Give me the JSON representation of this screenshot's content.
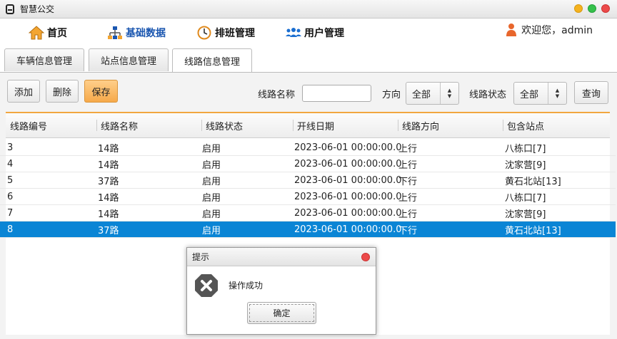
{
  "window": {
    "title": "智慧公交"
  },
  "nav": {
    "items": [
      {
        "label": "首页",
        "icon": "home-icon"
      },
      {
        "label": "基础数据",
        "icon": "hierarchy-icon"
      },
      {
        "label": "排班管理",
        "icon": "clock-icon"
      },
      {
        "label": "用户管理",
        "icon": "users-icon"
      }
    ],
    "active": "基础数据",
    "active_color": "#1a56b0",
    "welcome": "欢迎您，admin"
  },
  "tabs": [
    "车辆信息管理",
    "站点信息管理",
    "线路信息管理"
  ],
  "active_tab": "线路信息管理",
  "toolbar": {
    "add_label": "添加",
    "delete_label": "删除",
    "save_label": "保存",
    "route_name_label": "线路名称",
    "route_name_value": "",
    "direction_label": "方向",
    "direction_value": "全部",
    "status_label": "线路状态",
    "status_value": "全部",
    "query_label": "查询"
  },
  "table": {
    "columns": [
      "线路编号",
      "线路名称",
      "线路状态",
      "开线日期",
      "线路方向",
      "包含站点"
    ],
    "rows": [
      [
        "3",
        "14路",
        "启用",
        "2023-06-01 00:00:00.0",
        "上行",
        "八栋口[7]"
      ],
      [
        "4",
        "14路",
        "启用",
        "2023-06-01 00:00:00.0",
        "上行",
        "沈家营[9]"
      ],
      [
        "5",
        "37路",
        "启用",
        "2023-06-01 00:00:00.0",
        "下行",
        "黄石北站[13]"
      ],
      [
        "6",
        "14路",
        "启用",
        "2023-06-01 00:00:00.0",
        "上行",
        "八栋口[7]"
      ],
      [
        "7",
        "14路",
        "启用",
        "2023-06-01 00:00:00.0",
        "上行",
        "沈家营[9]"
      ],
      [
        "8",
        "37路",
        "启用",
        "2023-06-01 00:00:00.0",
        "下行",
        "黄石北站[13]"
      ]
    ],
    "selected_row": 5,
    "selected_color": "#0a85d5",
    "header_accent": "#f1a740"
  },
  "dialog": {
    "title": "提示",
    "message": "操作成功",
    "ok_label": "确定",
    "icon": "error-x-icon"
  }
}
